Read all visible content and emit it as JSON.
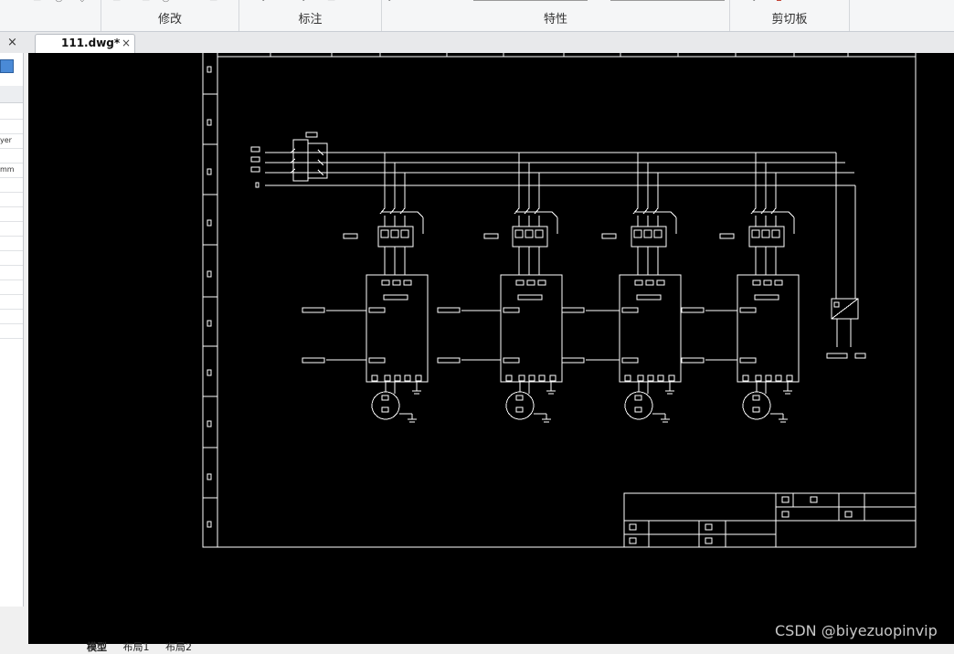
{
  "ribbon": {
    "groups": [
      {
        "label": "修改"
      },
      {
        "label": "标注"
      },
      {
        "label": "特性"
      },
      {
        "label": "剪切板"
      }
    ]
  },
  "document_tab": {
    "title": "111.dwg*",
    "close": "×"
  },
  "panel_close": "×",
  "properties_panel": {
    "rows": [
      "",
      "",
      "yer",
      "",
      "mm",
      "",
      "",
      "",
      "",
      "",
      "",
      "",
      "",
      "",
      "",
      ""
    ]
  },
  "layout_tabs": [
    "模型",
    "布局1",
    "布局2"
  ],
  "watermark": "CSDN @biyezuopinvip",
  "colors": {
    "canvas": "#000000",
    "lines": "#ffffff",
    "accent": "#4a8ad6"
  }
}
